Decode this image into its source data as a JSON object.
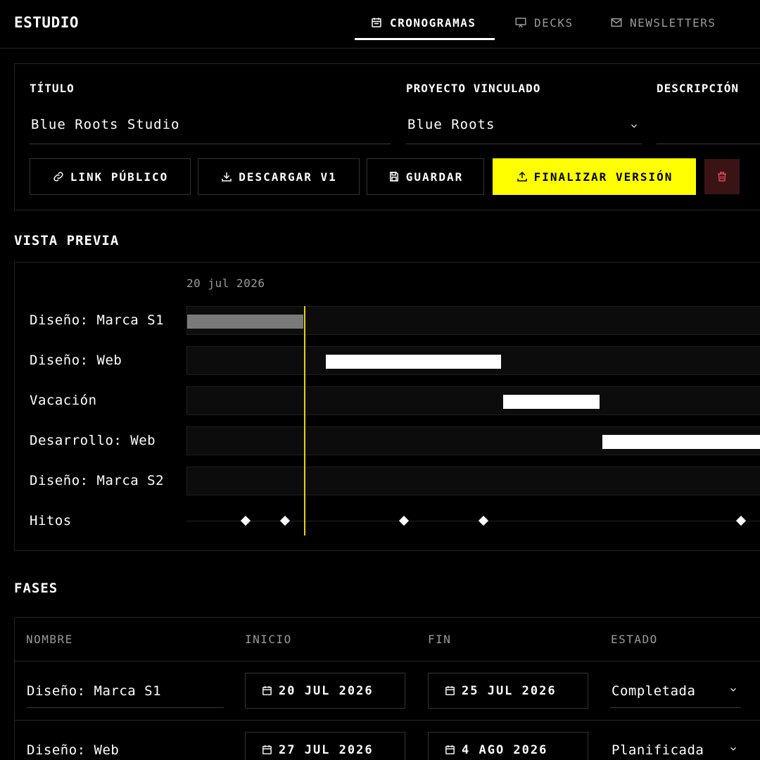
{
  "app": {
    "brand": "ESTUDIO"
  },
  "nav": {
    "tabs": [
      {
        "label": "CRONOGRAMAS",
        "icon": "calendar-icon",
        "active": true
      },
      {
        "label": "DECKS",
        "icon": "presentation-icon",
        "active": false
      },
      {
        "label": "NEWSLETTERS",
        "icon": "mail-icon",
        "active": false
      }
    ]
  },
  "form": {
    "title_label": "TÍTULO",
    "title_value": "Blue Roots Studio",
    "project_label": "PROYECTO VINCULADO",
    "project_value": "Blue Roots",
    "description_label": "DESCRIPCIÓN",
    "description_value": ""
  },
  "actions": {
    "public_link": "LINK PÚBLICO",
    "download": "DESCARGAR V1",
    "save": "GUARDAR",
    "finalize": "FINALIZAR VERSIÓN"
  },
  "preview": {
    "title": "VISTA PREVIA",
    "start_date": "20 jul 2026",
    "rows": [
      {
        "label": "Diseño: Marca S1",
        "status": "completed"
      },
      {
        "label": "Diseño: Web",
        "status": "planned"
      },
      {
        "label": "Vacación",
        "status": "planned"
      },
      {
        "label": "Desarrollo: Web",
        "status": "planned"
      },
      {
        "label": "Diseño: Marca S2",
        "status": "planned"
      }
    ],
    "milestones_label": "Hitos",
    "colors": {
      "completed": "#7a7a7a",
      "planned": "#ffffff",
      "today_line": "#e6d200",
      "accent": "#ffff00"
    }
  },
  "phases": {
    "title": "FASES",
    "columns": [
      "NOMBRE",
      "INICIO",
      "FIN",
      "ESTADO"
    ],
    "rows": [
      {
        "name": "Diseño: Marca S1",
        "start": "20 JUL 2026",
        "end": "25 JUL 2026",
        "status": "Completada"
      },
      {
        "name": "Diseño: Web",
        "start": "27 JUL 2026",
        "end": "4 AGO 2026",
        "status": "Planificada"
      }
    ]
  }
}
